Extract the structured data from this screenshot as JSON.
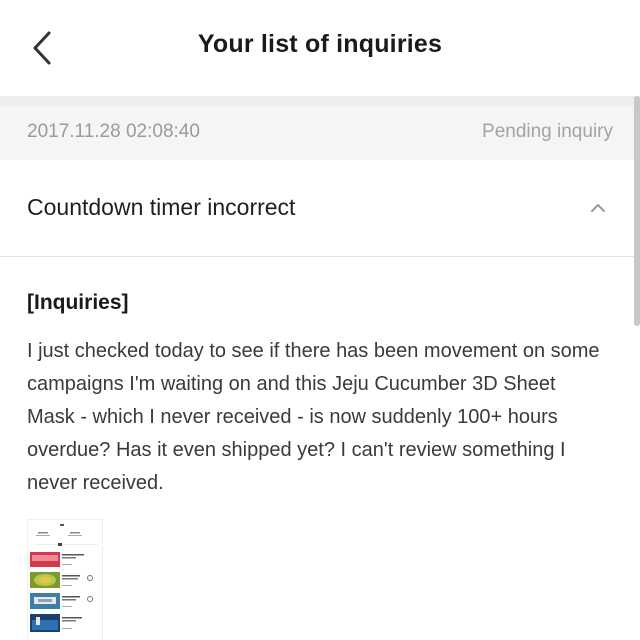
{
  "header": {
    "title": "Your list of inquiries",
    "back_icon": "chevron-left-icon"
  },
  "inquiry": {
    "date": "2017.11.28 02:08:40",
    "status": "Pending inquiry",
    "subject": "Countdown timer incorrect",
    "toggle_icon": "chevron-up-icon",
    "section_label": "[Inquiries]",
    "message": "I just checked today to see if there has been movement on some campaigns I'm waiting on and this Jeju Cucumber 3D Sheet Mask - which I never received - is now suddenly 100+ hours overdue? Has it even shipped yet? I can't review something I never received.",
    "attachment_icon": "screenshot-thumbnail"
  },
  "colors": {
    "separator": "#eeeeee",
    "meta_background": "#f5f5f5",
    "muted_text": "#9a9a9a",
    "scrollbar": "#c8c8c8"
  }
}
